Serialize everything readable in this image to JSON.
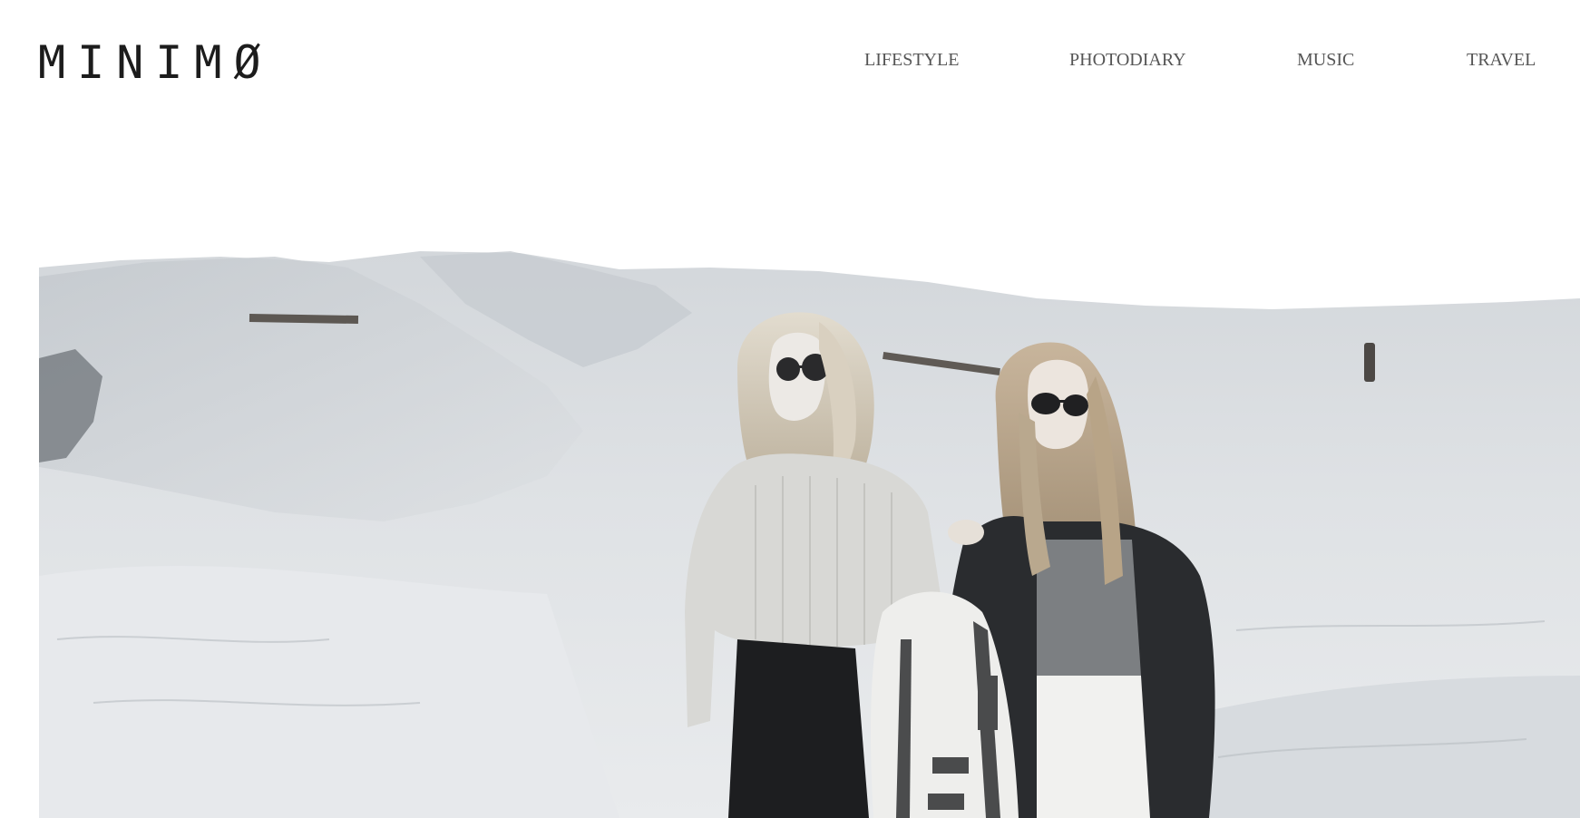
{
  "header": {
    "logo_text": "MINIMØ",
    "nav": [
      {
        "label": "LIFESTYLE"
      },
      {
        "label": "PHOTODIARY"
      },
      {
        "label": "MUSIC"
      },
      {
        "label": "TRAVEL"
      }
    ]
  },
  "hero": {
    "image_icon": "photo-two-women-on-sand-dunes",
    "palette": {
      "sky": "#ffffff",
      "sand_light": "#e4e7ea",
      "sand_mid": "#c9ced3",
      "sand_shadow": "#a9afb5",
      "hair": "#d2c7b5",
      "sweater": "#d9d9d6",
      "jacket": "#2a2c2f",
      "shirt": "#7c7f82",
      "skirt": "#1d1e20",
      "blanket": "#eeeeec"
    }
  }
}
